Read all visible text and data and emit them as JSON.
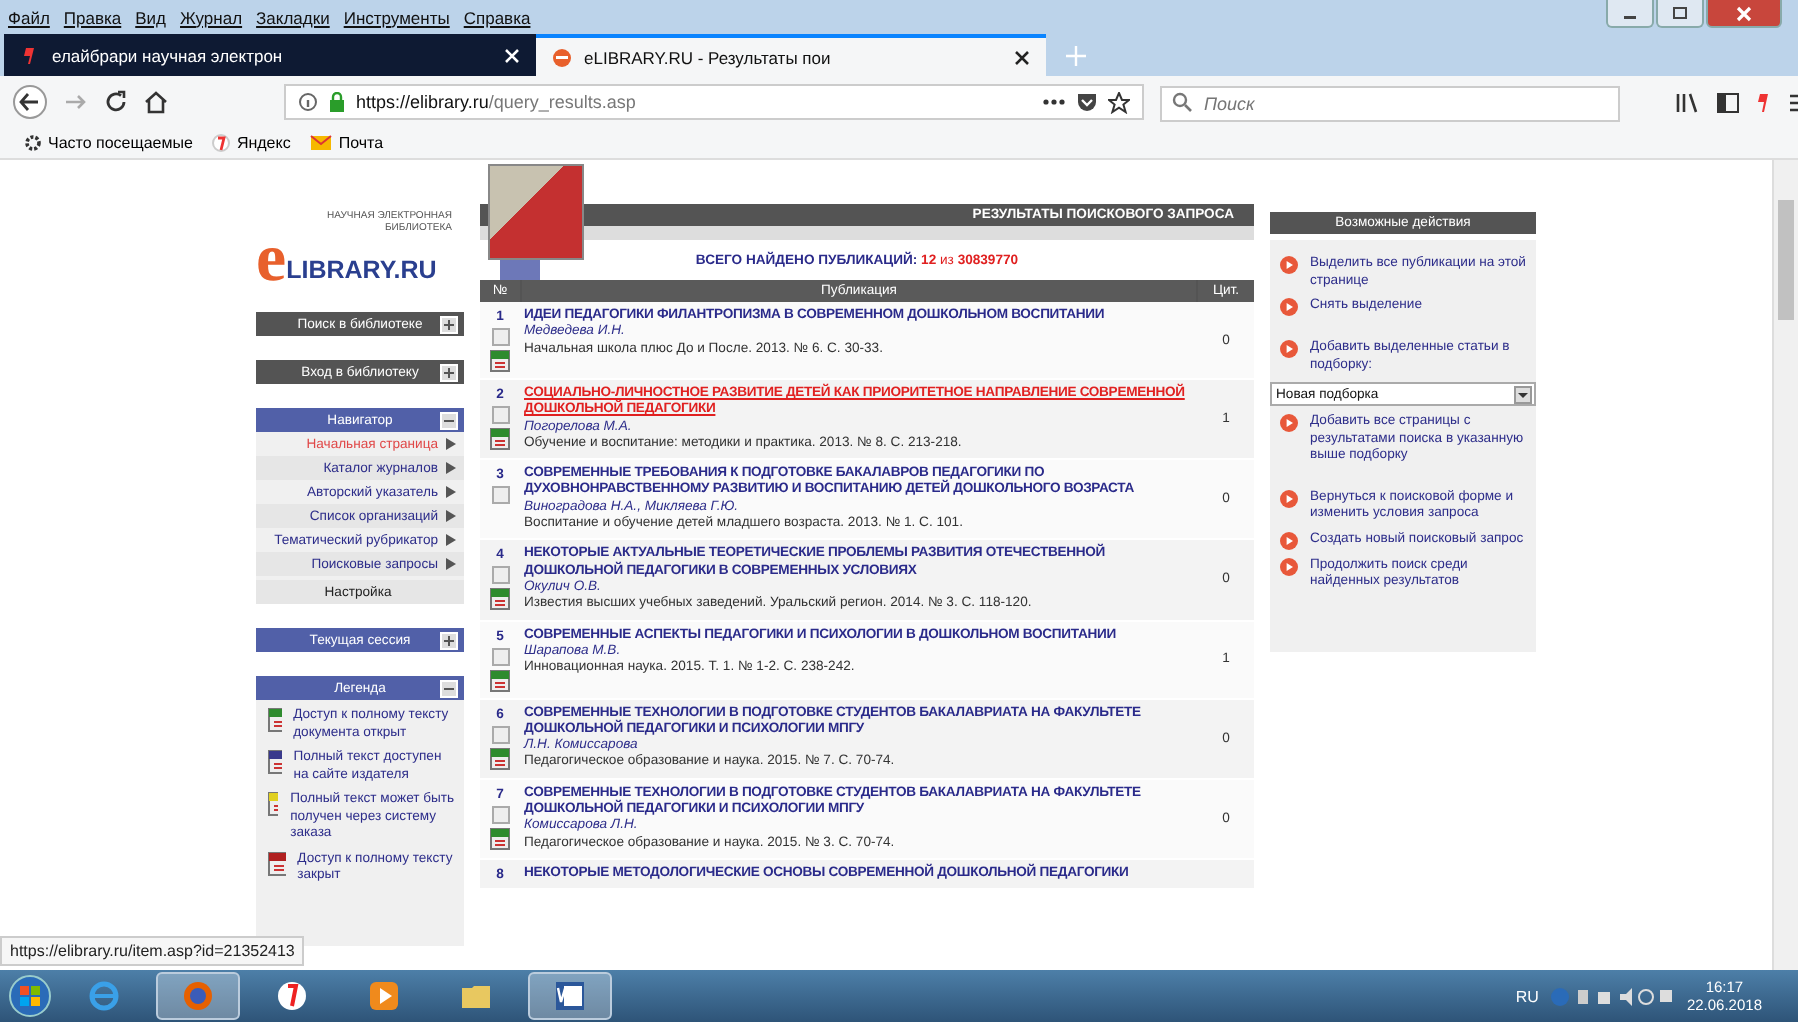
{
  "browser": {
    "menu": [
      "Файл",
      "Правка",
      "Вид",
      "Журнал",
      "Закладки",
      "Инструменты",
      "Справка"
    ],
    "tabs": [
      {
        "title": "елайбрари научная электрон",
        "selected": false,
        "kind": "yandex"
      },
      {
        "title": "eLIBRARY.RU - Результаты пои",
        "selected": true,
        "kind": "elibrary"
      }
    ],
    "url": {
      "host": "https://elibrary.ru",
      "path": "/query_results.asp"
    },
    "search": {
      "placeholder": "Поиск"
    },
    "bookmarks": [
      {
        "label": "Часто посещаемые",
        "kind": "gear"
      },
      {
        "label": "Яндекс",
        "kind": "yandex"
      },
      {
        "label": "Почта",
        "kind": "mail"
      }
    ],
    "status_url": "https://elibrary.ru/item.asp?id=21352413"
  },
  "sidebar": {
    "logo": {
      "tagline_1": "НАУЧНАЯ ЭЛЕКТРОННАЯ",
      "tagline_2": "БИБЛИОТЕКА",
      "letter": "e",
      "name": "LIBRARY.RU"
    },
    "panels": [
      {
        "title": "Поиск в библиотеке",
        "kind": "action",
        "expanded": false
      },
      {
        "title": "Вход в библиотеку",
        "kind": "action",
        "expanded": false
      },
      {
        "title": "Навигатор",
        "kind": "section",
        "expanded": true,
        "items": [
          {
            "label": "Начальная страница",
            "selected": true,
            "kind": "link"
          },
          {
            "label": "Каталог журналов",
            "selected": false,
            "kind": "link"
          },
          {
            "label": "Авторский указатель",
            "selected": false,
            "kind": "link"
          },
          {
            "label": "Список организаций",
            "selected": false,
            "kind": "link"
          },
          {
            "label": "Тематический рубрикатор",
            "selected": false,
            "kind": "link"
          },
          {
            "label": "Поисковые запросы",
            "selected": false,
            "kind": "link"
          },
          {
            "label": "Настройка",
            "selected": false,
            "kind": "plain"
          }
        ]
      },
      {
        "title": "Текущая сессия",
        "kind": "section",
        "expanded": false
      },
      {
        "title": "Легенда",
        "kind": "section",
        "expanded": true,
        "legend": [
          {
            "text": "Доступ к полному тексту документа открыт",
            "color": "#2e8b2e"
          },
          {
            "text": "Полный текст доступен на сайте издателя",
            "color": "#3a3a8c"
          },
          {
            "text": "Полный текст может быть получен через систему заказа",
            "color": "#e0d020"
          },
          {
            "text": "Доступ к полному тексту закрыт",
            "color": "#b02020"
          }
        ]
      }
    ]
  },
  "results": {
    "header": "РЕЗУЛЬТАТЫ ПОИСКОВОГО ЗАПРОСА",
    "total": {
      "label": "ВСЕГО НАЙДЕНО ПУБЛИКАЦИЙ:",
      "found": "12",
      "of": "из",
      "all": "30839770"
    },
    "columns": [
      "№",
      "Публикация",
      "Цит."
    ],
    "rows": [
      {
        "num": "1",
        "title": "ИДЕИ ПЕДАГОГИКИ ФИЛАНТРОПИЗМА В СОВРЕМЕННОМ ДОШКОЛЬНОМ ВОСПИТАНИИ",
        "authors": "Медведева И.Н.",
        "source": "Начальная школа плюс До и После. 2013. № 6. С. 30-33.",
        "citations": "0",
        "checked": false,
        "highlighted": false,
        "full_text": true
      },
      {
        "num": "2",
        "title": "СОЦИАЛЬНО-ЛИЧНОСТНОЕ РАЗВИТИЕ ДЕТЕЙ КАК ПРИОРИТЕТНОЕ НАПРАВЛЕНИЕ СОВРЕМЕННОЙ ДОШКОЛЬНОЙ ПЕДАГОГИКИ",
        "authors": "Погорелова М.А.",
        "source": "Обучение и воспитание: методики и практика. 2013. № 8. С. 213-218.",
        "citations": "1",
        "checked": false,
        "highlighted": true,
        "full_text": true
      },
      {
        "num": "3",
        "title": "СОВРЕМЕННЫЕ ТРЕБОВАНИЯ К ПОДГОТОВКЕ БАКАЛАВРОВ ПЕДАГОГИКИ ПО ДУХОВНОНРАВСТВЕННОМУ РАЗВИТИЮ И ВОСПИТАНИЮ ДЕТЕЙ ДОШКОЛЬНОГО ВОЗРАСТА",
        "authors": "Виноградова Н.А., Микляева Г.Ю.",
        "source": "Воспитание и обучение детей младшего возраста. 2013. № 1. С. 101.",
        "citations": "0",
        "checked": false,
        "highlighted": false,
        "full_text": false
      },
      {
        "num": "4",
        "title": "НЕКОТОРЫЕ АКТУАЛЬНЫЕ ТЕОРЕТИЧЕСКИЕ ПРОБЛЕМЫ РАЗВИТИЯ ОТЕЧЕСТВЕННОЙ ДОШКОЛЬНОЙ ПЕДАГОГИКИ В СОВРЕМЕННЫХ УСЛОВИЯХ",
        "authors": "Окулич О.В.",
        "source": "Известия высших учебных заведений. Уральский регион. 2014. № 3. С. 118-120.",
        "citations": "0",
        "checked": false,
        "highlighted": false,
        "full_text": true
      },
      {
        "num": "5",
        "title": "СОВРЕМЕННЫЕ АСПЕКТЫ ПЕДАГОГИКИ И ПСИХОЛОГИИ В ДОШКОЛЬНОМ ВОСПИТАНИИ",
        "authors": "Шарапова М.В.",
        "source": "Инновационная наука. 2015. Т. 1. № 1-2. С. 238-242.",
        "citations": "1",
        "checked": false,
        "highlighted": false,
        "full_text": true
      },
      {
        "num": "6",
        "title": "СОВРЕМЕННЫЕ ТЕХНОЛОГИИ В ПОДГОТОВКЕ СТУДЕНТОВ БАКАЛАВРИАТА НА ФАКУЛЬТЕТЕ ДОШКОЛЬНОЙ ПЕДАГОГИКИ И ПСИХОЛОГИИ МПГУ",
        "authors": "Л.Н. Комиссарова",
        "source": "Педагогическое образование и наука. 2015. № 7. С. 70-74.",
        "citations": "0",
        "checked": false,
        "highlighted": false,
        "full_text": true
      },
      {
        "num": "7",
        "title": "СОВРЕМЕННЫЕ ТЕХНОЛОГИИ В ПОДГОТОВКЕ СТУДЕНТОВ БАКАЛАВРИАТА НА ФАКУЛЬТЕТЕ ДОШКОЛЬНОЙ ПЕДАГОГИКИ И ПСИХОЛОГИИ МПГУ",
        "authors": "Комиссарова Л.Н.",
        "source": "Педагогическое образование и наука. 2015. № 3. С. 70-74.",
        "citations": "0",
        "checked": false,
        "highlighted": false,
        "full_text": true
      },
      {
        "num": "8",
        "title": "НЕКОТОРЫЕ МЕТОДОЛОГИЧЕСКИЕ ОСНОВЫ СОВРЕМЕННОЙ ДОШКОЛЬНОЙ ПЕДАГОГИКИ"
      }
    ]
  },
  "actions": {
    "header": "Возможные действия",
    "groups": [
      [
        {
          "kind": "link",
          "text": "Выделить все публикации на этой странице"
        },
        {
          "kind": "link",
          "text": "Снять выделение"
        }
      ],
      [
        {
          "kind": "link",
          "text": "Добавить выделенные статьи в подборку:"
        },
        {
          "kind": "select",
          "value": "Новая подборка"
        },
        {
          "kind": "link",
          "text": "Добавить все страницы с результатами поиска в указанную выше подборку"
        }
      ],
      [
        {
          "kind": "link",
          "text": "Вернуться к поисковой форме и изменить условия запроса"
        },
        {
          "kind": "link",
          "text": "Создать новый поисковый запрос"
        },
        {
          "kind": "link",
          "text": "Продолжить поиск среди найденных результатов"
        }
      ]
    ]
  },
  "taskbar": {
    "apps": [
      {
        "kind": "ie",
        "selected": false
      },
      {
        "kind": "firefox",
        "selected": true
      },
      {
        "kind": "yandex",
        "selected": false
      },
      {
        "kind": "player",
        "selected": false
      },
      {
        "kind": "folder",
        "selected": false
      },
      {
        "kind": "word",
        "selected": true
      }
    ],
    "language": "RU",
    "time": "16:17",
    "date": "22.06.2018"
  }
}
